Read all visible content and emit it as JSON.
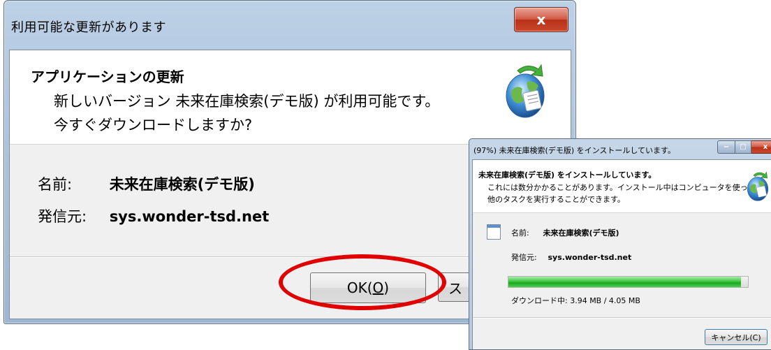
{
  "dialog_update": {
    "title": "利用可能な更新があります",
    "close_glyph": "x",
    "heading": "アプリケーションの更新",
    "message": "新しいバージョン 未来在庫検索(デモ版) が利用可能です。今すぐダウンロードしますか?",
    "name_label": "名前:",
    "name_value": "未来在庫検索(デモ版)",
    "publisher_label": "発信元:",
    "publisher_value": "sys.wonder-tsd.net",
    "ok_label_prefix": "OK(",
    "ok_accel": "O",
    "ok_label_suffix": ")",
    "skip_label": "ス",
    "icon": "globe-update-icon",
    "highlight_color": "#e10000"
  },
  "dialog_install": {
    "title": "(97%) 未来在庫検索(デモ版) をインストールしています。",
    "min_glyph": "−",
    "max_glyph": "□",
    "close_glyph": "x",
    "heading": "未来在庫検索(デモ版) をインストールしています。",
    "message": "これには数分かかることがあります。インストール中はコンピュータを使って他のタスクを実行することができます。",
    "name_label": "名前:",
    "name_value": "未来在庫検索(デモ版)",
    "publisher_label": "発信元:",
    "publisher_value": "sys.wonder-tsd.net",
    "progress_fraction": 0.97,
    "status": "ダウンロード中: 3.94 MB / 4.05 MB",
    "cancel_label": "キャンセル(C)",
    "icon": "globe-update-icon"
  }
}
